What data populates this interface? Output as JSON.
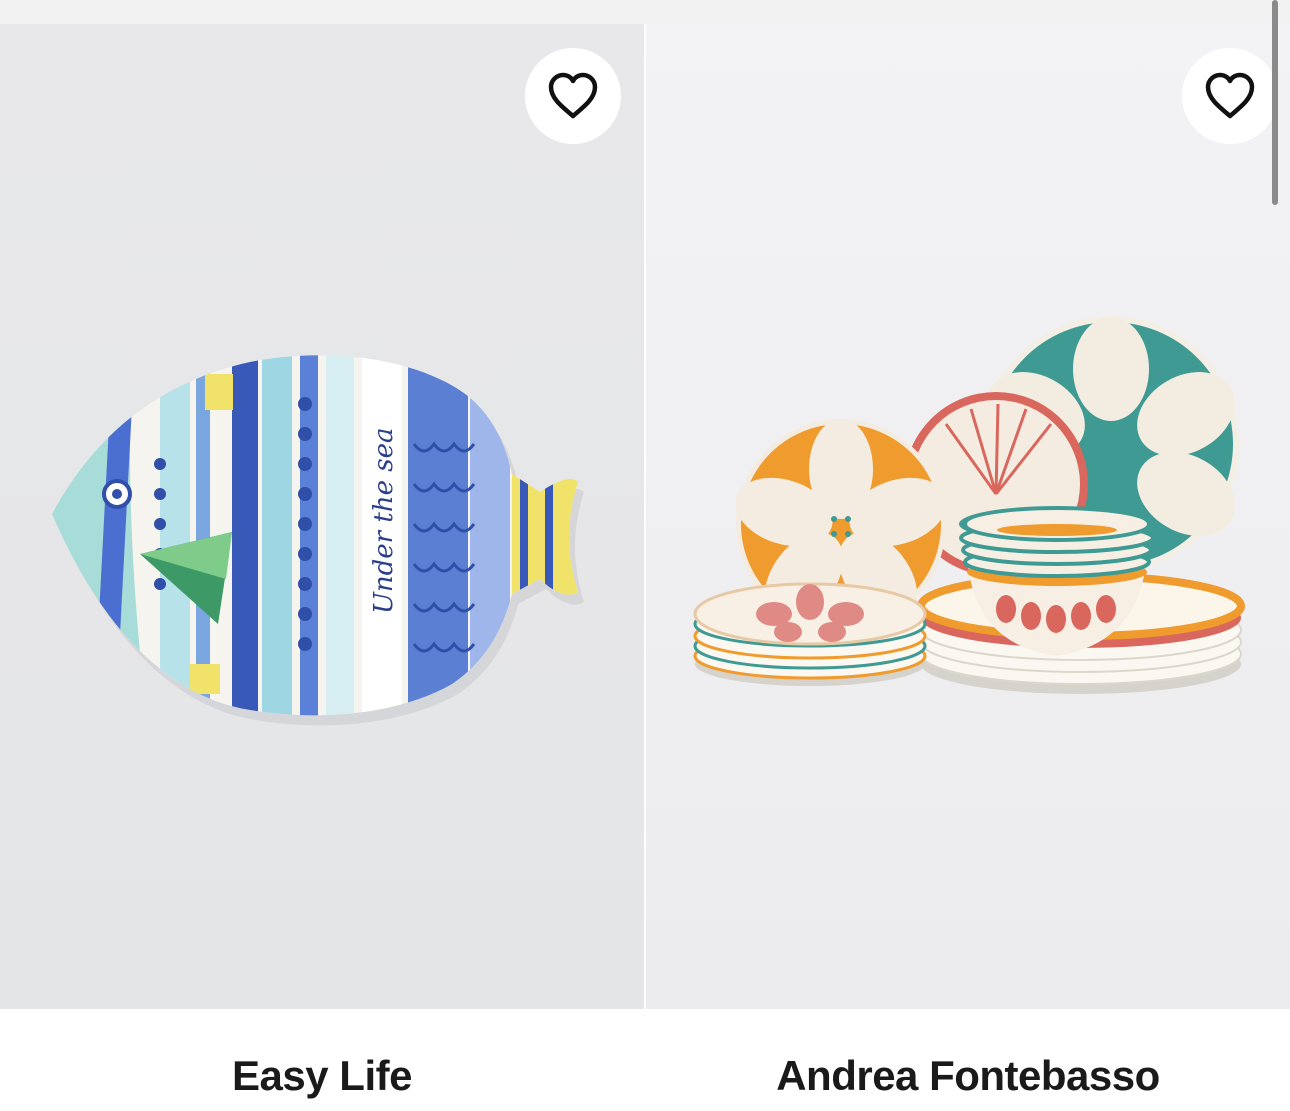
{
  "products": [
    {
      "brand": "Easy Life",
      "image_alt": "Fish-shaped platter",
      "image_text": "Under the sea",
      "favorite_icon": "heart-outline-icon"
    },
    {
      "brand": "Andrea Fontebasso",
      "image_alt": "Patterned dinnerware set",
      "favorite_icon": "heart-outline-icon"
    }
  ],
  "colors": {
    "brand_text": "#1a1a1a",
    "fish_blue": "#3a5cc0",
    "fish_light": "#8fd0dc",
    "orange": "#ef9b2d",
    "teal": "#3f9a93",
    "coral": "#d9675d"
  }
}
